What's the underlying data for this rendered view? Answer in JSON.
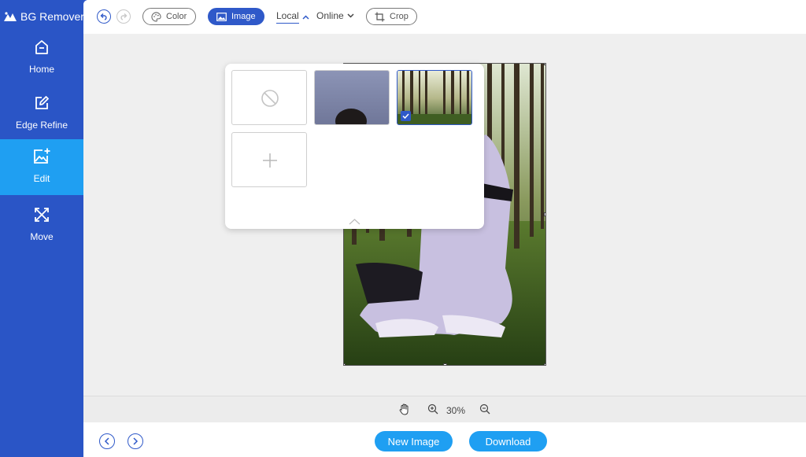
{
  "app": {
    "title": "BG Remover"
  },
  "sidebar": {
    "items": [
      {
        "label": "Home",
        "icon": "home-icon",
        "active": false
      },
      {
        "label": "Edge Refine",
        "icon": "edit-square-icon",
        "active": false
      },
      {
        "label": "Edit",
        "icon": "image-plus-icon",
        "active": true
      },
      {
        "label": "Move",
        "icon": "arrows-expand-icon",
        "active": false
      }
    ]
  },
  "toolbar": {
    "color_label": "Color",
    "image_label": "Image",
    "local_label": "Local",
    "online_label": "Online",
    "crop_label": "Crop"
  },
  "zoom": {
    "percent": "30%"
  },
  "footer": {
    "new_image_label": "New Image",
    "download_label": "Download"
  },
  "colors": {
    "sidebar_bg": "#2a55c6",
    "active_item": "#1f9ff2",
    "primary": "#2f59c9",
    "canvas_bg": "#efefef"
  }
}
